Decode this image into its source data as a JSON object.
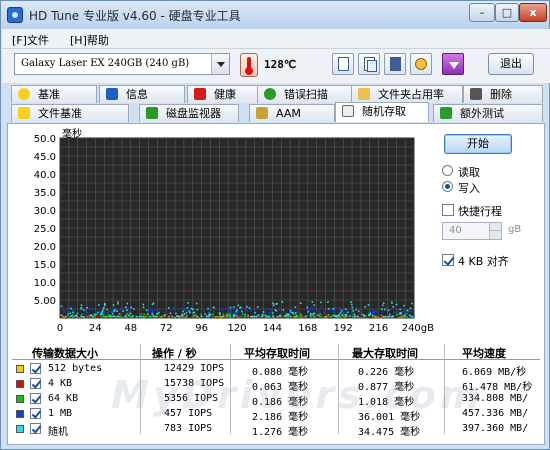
{
  "window": {
    "title": "HD Tune 专业版 v4.60 - 硬盘专业工具",
    "btn_min": "–",
    "btn_max": "□",
    "btn_close": "x"
  },
  "menu": [
    {
      "label": "[F]文件"
    },
    {
      "label": "[H]帮助"
    }
  ],
  "toolbar": {
    "drive": "Galaxy Laser EX 240GB    (240 gB)",
    "temperature": "128℃",
    "exit_label": "退出"
  },
  "tabs_row1": [
    {
      "label": "基准",
      "icon": "bulb-icon"
    },
    {
      "label": "信息",
      "icon": "info-icon"
    },
    {
      "label": "健康",
      "icon": "health-cross-icon"
    },
    {
      "label": "错误扫描",
      "icon": "magnifier-icon"
    },
    {
      "label": "文件夹占用率",
      "icon": "folder-icon"
    },
    {
      "label": "删除",
      "icon": "trash-icon"
    }
  ],
  "tabs_row2": [
    {
      "label": "文件基准",
      "icon": "file-bulb-icon"
    },
    {
      "label": "磁盘监视器",
      "icon": "monitor-icon"
    },
    {
      "label": "AAM",
      "icon": "speaker-icon"
    },
    {
      "label": "随机存取",
      "icon": "random-access-icon",
      "active": true
    },
    {
      "label": "额外测试",
      "icon": "extra-test-icon"
    }
  ],
  "controls": {
    "start_label": "开始",
    "read_label": "读取",
    "write_label": "写入",
    "mode_selected": "写入",
    "short_stroke_label": "快捷行程",
    "short_stroke_checked": false,
    "short_stroke_value": "40",
    "short_stroke_unit": "gB",
    "align_label": "4 KB 对齐",
    "align_checked": true
  },
  "chart_data": {
    "type": "scatter",
    "ylabel": "毫秒",
    "ylim": [
      0,
      50
    ],
    "yticks": [
      "50.0",
      "45.0",
      "40.0",
      "35.0",
      "30.0",
      "25.0",
      "20.0",
      "15.0",
      "10.0",
      "5.00"
    ],
    "ytick_values": [
      50,
      45,
      40,
      35,
      30,
      25,
      20,
      15,
      10,
      5
    ],
    "xlim": [
      0,
      240
    ],
    "xticks": [
      "0",
      "24",
      "48",
      "72",
      "96",
      "120",
      "144",
      "168",
      "192",
      "216",
      "240gB"
    ],
    "xtick_values": [
      0,
      24,
      48,
      72,
      96,
      120,
      144,
      168,
      192,
      216,
      240
    ],
    "grid": true,
    "background": "#282828",
    "grid_color": "#5a5a5a",
    "series": [
      {
        "name": "512 bytes",
        "color": "#f0d000",
        "latency_range_ms": [
          0.0,
          0.4
        ]
      },
      {
        "name": "4 KB",
        "color": "#d01010",
        "latency_range_ms": [
          0.0,
          0.9
        ]
      },
      {
        "name": "64 KB",
        "color": "#10c010",
        "latency_range_ms": [
          0.2,
          1.2
        ]
      },
      {
        "name": "1 MB",
        "color": "#1040e0",
        "latency_range_ms": [
          1.5,
          3.0
        ]
      },
      {
        "name": "随机",
        "color": "#30d8e8",
        "latency_range_ms": [
          0.3,
          4.5
        ]
      }
    ]
  },
  "table": {
    "headers": [
      "传输数据大小",
      "操作 / 秒",
      "平均存取时间",
      "最大存取时间",
      "平均速度"
    ],
    "rows": [
      {
        "color": "#f0d000",
        "size": "512 bytes",
        "ops": "12429 IOPS",
        "avg": "0.080 毫秒",
        "max": "0.226 毫秒",
        "speed": "6.069 MB/秒"
      },
      {
        "color": "#d01010",
        "size": "4 KB",
        "ops": "15738 IOPS",
        "avg": "0.063 毫秒",
        "max": "0.877 毫秒",
        "speed": "61.478 MB/秒"
      },
      {
        "color": "#10c010",
        "size": "64 KB",
        "ops": "5356 IOPS",
        "avg": "0.186 毫秒",
        "max": "1.018 毫秒",
        "speed": "334.808 MB/"
      },
      {
        "color": "#1040e0",
        "size": "1 MB",
        "ops": "457 IOPS",
        "avg": "2.186 毫秒",
        "max": "36.001 毫秒",
        "speed": "457.336 MB/"
      },
      {
        "color": "#30d8e8",
        "size": "随机",
        "ops": "783 IOPS",
        "avg": "1.276 毫秒",
        "max": "34.475 毫秒",
        "speed": "397.360 MB/"
      }
    ]
  },
  "watermark": "MyDrivers.com"
}
